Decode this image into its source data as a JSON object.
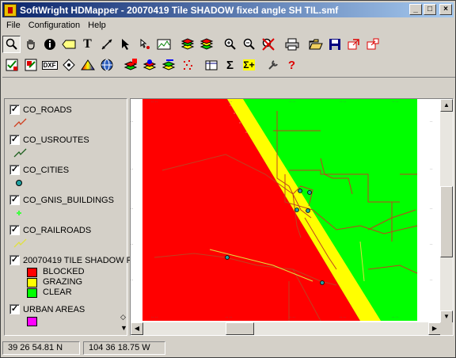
{
  "window": {
    "title": "SoftWright HDMapper - 20070419  Tile SHADOW fixed angle SH TIL.smf"
  },
  "menu": [
    "File",
    "Configuration",
    "Help"
  ],
  "toolbar1": [
    "zoom-icon",
    "pan-hand-icon",
    "info-icon",
    "label-icon",
    "text-icon",
    "measure-icon",
    "select-arrow-icon",
    "pick-icon",
    "profile-icon",
    "layers-icon",
    "layers-edit-icon",
    "zoom-in-icon",
    "zoom-out-icon",
    "zoom-cancel-icon",
    "print-icon",
    "open-folder-icon",
    "save-icon",
    "export-icon",
    "export-alt-icon"
  ],
  "toolbar2": [
    "check-icon",
    "close-layer-icon",
    "dxf-icon",
    "waypoint-icon",
    "color-ramp-icon",
    "globe-icon",
    "add-layer-icon",
    "remove-layer-icon",
    "edit-layer-icon",
    "sparkle-icon",
    "table-icon",
    "sum-icon",
    "sum-plus-icon",
    "wrench-icon",
    "help-icon"
  ],
  "toolbar2_labels": {
    "dxf": "DXF",
    "sum": "Σ",
    "sum_plus": "Σ+",
    "help": "?"
  },
  "legend": {
    "layers": [
      {
        "name": "CO_ROADS",
        "checked": true,
        "color": "#d04020"
      },
      {
        "name": "CO_USROUTES",
        "checked": true,
        "color": "#206020"
      },
      {
        "name": "CO_CITIES",
        "checked": true,
        "color": "#20a0a0"
      },
      {
        "name": "CO_GNIS_BUILDINGS",
        "checked": true,
        "color": "#40ff40"
      },
      {
        "name": "CO_RAILROADS",
        "checked": true,
        "color": "#e0e040"
      },
      {
        "name": "20070419  TILE SHADOW F",
        "checked": true
      },
      {
        "name": "URBAN AREAS",
        "checked": true,
        "color": "#ff00ff"
      }
    ],
    "shadow_classes": [
      {
        "label": "BLOCKED",
        "color": "#ff0000"
      },
      {
        "label": "GRAZING",
        "color": "#ffff00"
      },
      {
        "label": "CLEAR",
        "color": "#00ff00"
      }
    ]
  },
  "status": {
    "lat": "39 26 54.81 N",
    "lon": "104 36 18.75 W"
  }
}
